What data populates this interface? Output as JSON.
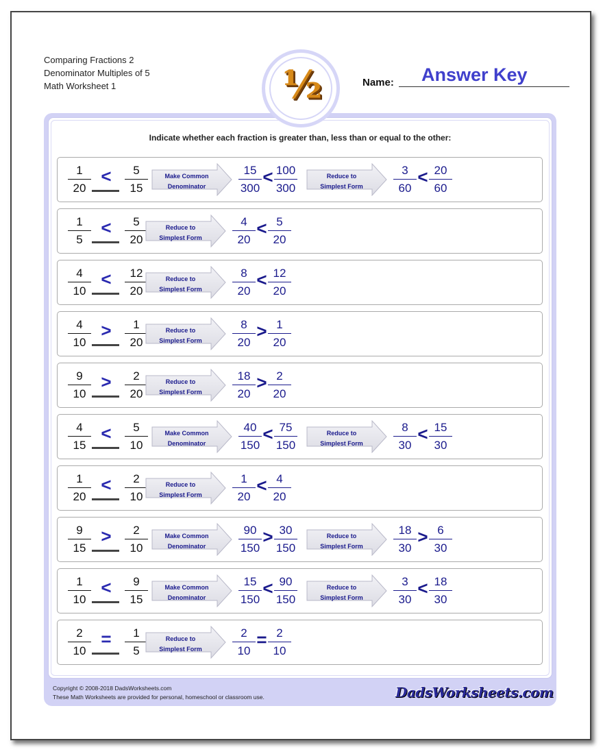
{
  "header": {
    "lines": [
      "Comparing Fractions 2",
      "Denominator Multiples of 5",
      "Math Worksheet 1"
    ],
    "name_label": "Name:",
    "name_value": "Answer Key",
    "logo_glyph": "½"
  },
  "instructions": "Indicate whether each fraction is greater than, less than or equal to the other:",
  "arrow_labels": {
    "common": [
      "Make Common",
      "Denominator"
    ],
    "reduce": [
      "Reduce to",
      "Simplest Form"
    ]
  },
  "problems": [
    {
      "left": [
        "1",
        "20"
      ],
      "right": [
        "5",
        "15"
      ],
      "answer": "<",
      "steps": [
        {
          "type": "common",
          "result": [
            [
              "15",
              "300"
            ],
            "<",
            [
              "100",
              "300"
            ]
          ]
        },
        {
          "type": "reduce",
          "result": [
            [
              "3",
              "60"
            ],
            "<",
            [
              "20",
              "60"
            ]
          ]
        }
      ]
    },
    {
      "left": [
        "1",
        "5"
      ],
      "right": [
        "5",
        "20"
      ],
      "answer": "<",
      "steps": [
        {
          "type": "reduce",
          "result": [
            [
              "4",
              "20"
            ],
            "<",
            [
              "5",
              "20"
            ]
          ]
        }
      ]
    },
    {
      "left": [
        "4",
        "10"
      ],
      "right": [
        "12",
        "20"
      ],
      "answer": "<",
      "steps": [
        {
          "type": "reduce",
          "result": [
            [
              "8",
              "20"
            ],
            "<",
            [
              "12",
              "20"
            ]
          ]
        }
      ]
    },
    {
      "left": [
        "4",
        "10"
      ],
      "right": [
        "1",
        "20"
      ],
      "answer": ">",
      "steps": [
        {
          "type": "reduce",
          "result": [
            [
              "8",
              "20"
            ],
            ">",
            [
              "1",
              "20"
            ]
          ]
        }
      ]
    },
    {
      "left": [
        "9",
        "10"
      ],
      "right": [
        "2",
        "20"
      ],
      "answer": ">",
      "steps": [
        {
          "type": "reduce",
          "result": [
            [
              "18",
              "20"
            ],
            ">",
            [
              "2",
              "20"
            ]
          ]
        }
      ]
    },
    {
      "left": [
        "4",
        "15"
      ],
      "right": [
        "5",
        "10"
      ],
      "answer": "<",
      "steps": [
        {
          "type": "common",
          "result": [
            [
              "40",
              "150"
            ],
            "<",
            [
              "75",
              "150"
            ]
          ]
        },
        {
          "type": "reduce",
          "result": [
            [
              "8",
              "30"
            ],
            "<",
            [
              "15",
              "30"
            ]
          ]
        }
      ]
    },
    {
      "left": [
        "1",
        "20"
      ],
      "right": [
        "2",
        "10"
      ],
      "answer": "<",
      "steps": [
        {
          "type": "reduce",
          "result": [
            [
              "1",
              "20"
            ],
            "<",
            [
              "4",
              "20"
            ]
          ]
        }
      ]
    },
    {
      "left": [
        "9",
        "15"
      ],
      "right": [
        "2",
        "10"
      ],
      "answer": ">",
      "steps": [
        {
          "type": "common",
          "result": [
            [
              "90",
              "150"
            ],
            ">",
            [
              "30",
              "150"
            ]
          ]
        },
        {
          "type": "reduce",
          "result": [
            [
              "18",
              "30"
            ],
            ">",
            [
              "6",
              "30"
            ]
          ]
        }
      ]
    },
    {
      "left": [
        "1",
        "10"
      ],
      "right": [
        "9",
        "15"
      ],
      "answer": "<",
      "steps": [
        {
          "type": "common",
          "result": [
            [
              "15",
              "150"
            ],
            "<",
            [
              "90",
              "150"
            ]
          ]
        },
        {
          "type": "reduce",
          "result": [
            [
              "3",
              "30"
            ],
            "<",
            [
              "18",
              "30"
            ]
          ]
        }
      ]
    },
    {
      "left": [
        "2",
        "10"
      ],
      "right": [
        "1",
        "5"
      ],
      "answer": "=",
      "steps": [
        {
          "type": "reduce",
          "result": [
            [
              "2",
              "10"
            ],
            "=",
            [
              "2",
              "10"
            ]
          ]
        }
      ]
    }
  ],
  "footer": {
    "copyright": "Copyright © 2008-2018 DadsWorksheets.com",
    "notice": "These Math Worksheets are provided for personal, homeschool or classroom use.",
    "brand": "DadsWorksheets.com"
  },
  "colors": {
    "answer_blue": "#2a2ab0",
    "work_blue": "#1a1a8c",
    "frame_lavender": "#d2d2f5",
    "name_blue": "#4040cc",
    "logo_orange": "#d88a18"
  }
}
